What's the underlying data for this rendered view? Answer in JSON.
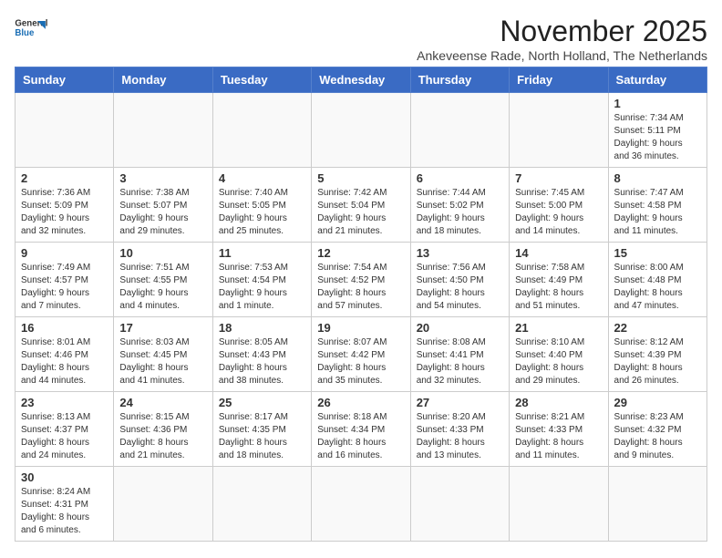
{
  "header": {
    "logo_line1": "General",
    "logo_line2": "Blue",
    "title": "November 2025",
    "subtitle": "Ankeveense Rade, North Holland, The Netherlands"
  },
  "weekdays": [
    "Sunday",
    "Monday",
    "Tuesday",
    "Wednesday",
    "Thursday",
    "Friday",
    "Saturday"
  ],
  "weeks": [
    [
      {
        "day": "",
        "info": ""
      },
      {
        "day": "",
        "info": ""
      },
      {
        "day": "",
        "info": ""
      },
      {
        "day": "",
        "info": ""
      },
      {
        "day": "",
        "info": ""
      },
      {
        "day": "",
        "info": ""
      },
      {
        "day": "1",
        "info": "Sunrise: 7:34 AM\nSunset: 5:11 PM\nDaylight: 9 hours\nand 36 minutes."
      }
    ],
    [
      {
        "day": "2",
        "info": "Sunrise: 7:36 AM\nSunset: 5:09 PM\nDaylight: 9 hours\nand 32 minutes."
      },
      {
        "day": "3",
        "info": "Sunrise: 7:38 AM\nSunset: 5:07 PM\nDaylight: 9 hours\nand 29 minutes."
      },
      {
        "day": "4",
        "info": "Sunrise: 7:40 AM\nSunset: 5:05 PM\nDaylight: 9 hours\nand 25 minutes."
      },
      {
        "day": "5",
        "info": "Sunrise: 7:42 AM\nSunset: 5:04 PM\nDaylight: 9 hours\nand 21 minutes."
      },
      {
        "day": "6",
        "info": "Sunrise: 7:44 AM\nSunset: 5:02 PM\nDaylight: 9 hours\nand 18 minutes."
      },
      {
        "day": "7",
        "info": "Sunrise: 7:45 AM\nSunset: 5:00 PM\nDaylight: 9 hours\nand 14 minutes."
      },
      {
        "day": "8",
        "info": "Sunrise: 7:47 AM\nSunset: 4:58 PM\nDaylight: 9 hours\nand 11 minutes."
      }
    ],
    [
      {
        "day": "9",
        "info": "Sunrise: 7:49 AM\nSunset: 4:57 PM\nDaylight: 9 hours\nand 7 minutes."
      },
      {
        "day": "10",
        "info": "Sunrise: 7:51 AM\nSunset: 4:55 PM\nDaylight: 9 hours\nand 4 minutes."
      },
      {
        "day": "11",
        "info": "Sunrise: 7:53 AM\nSunset: 4:54 PM\nDaylight: 9 hours\nand 1 minute."
      },
      {
        "day": "12",
        "info": "Sunrise: 7:54 AM\nSunset: 4:52 PM\nDaylight: 8 hours\nand 57 minutes."
      },
      {
        "day": "13",
        "info": "Sunrise: 7:56 AM\nSunset: 4:50 PM\nDaylight: 8 hours\nand 54 minutes."
      },
      {
        "day": "14",
        "info": "Sunrise: 7:58 AM\nSunset: 4:49 PM\nDaylight: 8 hours\nand 51 minutes."
      },
      {
        "day": "15",
        "info": "Sunrise: 8:00 AM\nSunset: 4:48 PM\nDaylight: 8 hours\nand 47 minutes."
      }
    ],
    [
      {
        "day": "16",
        "info": "Sunrise: 8:01 AM\nSunset: 4:46 PM\nDaylight: 8 hours\nand 44 minutes."
      },
      {
        "day": "17",
        "info": "Sunrise: 8:03 AM\nSunset: 4:45 PM\nDaylight: 8 hours\nand 41 minutes."
      },
      {
        "day": "18",
        "info": "Sunrise: 8:05 AM\nSunset: 4:43 PM\nDaylight: 8 hours\nand 38 minutes."
      },
      {
        "day": "19",
        "info": "Sunrise: 8:07 AM\nSunset: 4:42 PM\nDaylight: 8 hours\nand 35 minutes."
      },
      {
        "day": "20",
        "info": "Sunrise: 8:08 AM\nSunset: 4:41 PM\nDaylight: 8 hours\nand 32 minutes."
      },
      {
        "day": "21",
        "info": "Sunrise: 8:10 AM\nSunset: 4:40 PM\nDaylight: 8 hours\nand 29 minutes."
      },
      {
        "day": "22",
        "info": "Sunrise: 8:12 AM\nSunset: 4:39 PM\nDaylight: 8 hours\nand 26 minutes."
      }
    ],
    [
      {
        "day": "23",
        "info": "Sunrise: 8:13 AM\nSunset: 4:37 PM\nDaylight: 8 hours\nand 24 minutes."
      },
      {
        "day": "24",
        "info": "Sunrise: 8:15 AM\nSunset: 4:36 PM\nDaylight: 8 hours\nand 21 minutes."
      },
      {
        "day": "25",
        "info": "Sunrise: 8:17 AM\nSunset: 4:35 PM\nDaylight: 8 hours\nand 18 minutes."
      },
      {
        "day": "26",
        "info": "Sunrise: 8:18 AM\nSunset: 4:34 PM\nDaylight: 8 hours\nand 16 minutes."
      },
      {
        "day": "27",
        "info": "Sunrise: 8:20 AM\nSunset: 4:33 PM\nDaylight: 8 hours\nand 13 minutes."
      },
      {
        "day": "28",
        "info": "Sunrise: 8:21 AM\nSunset: 4:33 PM\nDaylight: 8 hours\nand 11 minutes."
      },
      {
        "day": "29",
        "info": "Sunrise: 8:23 AM\nSunset: 4:32 PM\nDaylight: 8 hours\nand 9 minutes."
      }
    ],
    [
      {
        "day": "30",
        "info": "Sunrise: 8:24 AM\nSunset: 4:31 PM\nDaylight: 8 hours\nand 6 minutes."
      },
      {
        "day": "",
        "info": ""
      },
      {
        "day": "",
        "info": ""
      },
      {
        "day": "",
        "info": ""
      },
      {
        "day": "",
        "info": ""
      },
      {
        "day": "",
        "info": ""
      },
      {
        "day": "",
        "info": ""
      }
    ]
  ]
}
